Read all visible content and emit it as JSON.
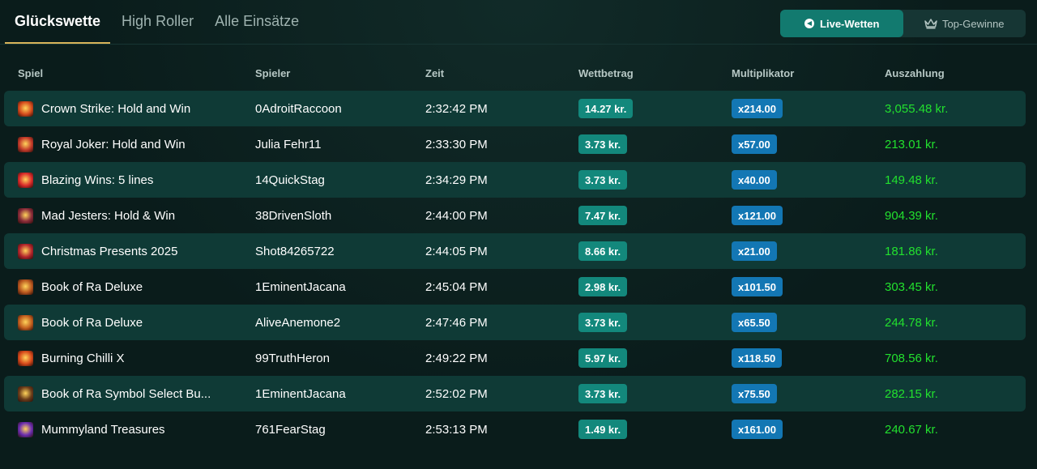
{
  "tabs": [
    {
      "label": "Glückswette",
      "active": true
    },
    {
      "label": "High Roller",
      "active": false
    },
    {
      "label": "Alle Einsätze",
      "active": false
    }
  ],
  "toggle": {
    "live": {
      "label": "Live-Wetten",
      "icon": "live-icon",
      "active": true
    },
    "top": {
      "label": "Top-Gewinne",
      "icon": "crown-icon",
      "active": false
    }
  },
  "columns": {
    "game": "Spiel",
    "player": "Spieler",
    "time": "Zeit",
    "bet": "Wettbetrag",
    "multiplier": "Multiplikator",
    "payout": "Auszahlung"
  },
  "colors": {
    "accent": "#127a6f",
    "bet_badge": "#13887c",
    "mult_badge": "#1377b4",
    "payout": "#22e02e",
    "tab_underline": "#d9b45a"
  },
  "rows": [
    {
      "game": "Crown Strike: Hold and Win",
      "icon_color": "#d44a1c",
      "player": "0AdroitRaccoon",
      "time": "2:32:42 PM",
      "bet": "14.27 kr.",
      "multiplier": "x214.00",
      "payout": "3,055.48 kr."
    },
    {
      "game": "Royal Joker: Hold and Win",
      "icon_color": "#c43a2a",
      "player": "Julia Fehr11",
      "time": "2:33:30 PM",
      "bet": "3.73 kr.",
      "multiplier": "x57.00",
      "payout": "213.01 kr."
    },
    {
      "game": "Blazing Wins: 5 lines",
      "icon_color": "#d8292a",
      "player": "14QuickStag",
      "time": "2:34:29 PM",
      "bet": "3.73 kr.",
      "multiplier": "x40.00",
      "payout": "149.48 kr."
    },
    {
      "game": "Mad Jesters: Hold & Win",
      "icon_color": "#8a2b3a",
      "player": "38DrivenSloth",
      "time": "2:44:00 PM",
      "bet": "7.47 kr.",
      "multiplier": "x121.00",
      "payout": "904.39 kr."
    },
    {
      "game": "Christmas Presents 2025",
      "icon_color": "#b3242c",
      "player": "Shot84265722",
      "time": "2:44:05 PM",
      "bet": "8.66 kr.",
      "multiplier": "x21.00",
      "payout": "181.86 kr."
    },
    {
      "game": "Book of Ra Deluxe",
      "icon_color": "#b8561e",
      "player": "1EminentJacana",
      "time": "2:45:04 PM",
      "bet": "2.98 kr.",
      "multiplier": "x101.50",
      "payout": "303.45 kr."
    },
    {
      "game": "Book of Ra Deluxe",
      "icon_color": "#c25e1e",
      "player": "AliveAnemone2",
      "time": "2:47:46 PM",
      "bet": "3.73 kr.",
      "multiplier": "x65.50",
      "payout": "244.78 kr."
    },
    {
      "game": "Burning Chilli X",
      "icon_color": "#d6481a",
      "player": "99TruthHeron",
      "time": "2:49:22 PM",
      "bet": "5.97 kr.",
      "multiplier": "x118.50",
      "payout": "708.56 kr."
    },
    {
      "game": "Book of Ra Symbol Select Bu...",
      "icon_color": "#6b3d1a",
      "player": "1EminentJacana",
      "time": "2:52:02 PM",
      "bet": "3.73 kr.",
      "multiplier": "x75.50",
      "payout": "282.15 kr."
    },
    {
      "game": "Mummyland Treasures",
      "icon_color": "#6a2cb0",
      "player": "761FearStag",
      "time": "2:53:13 PM",
      "bet": "1.49 kr.",
      "multiplier": "x161.00",
      "payout": "240.67 kr."
    }
  ]
}
